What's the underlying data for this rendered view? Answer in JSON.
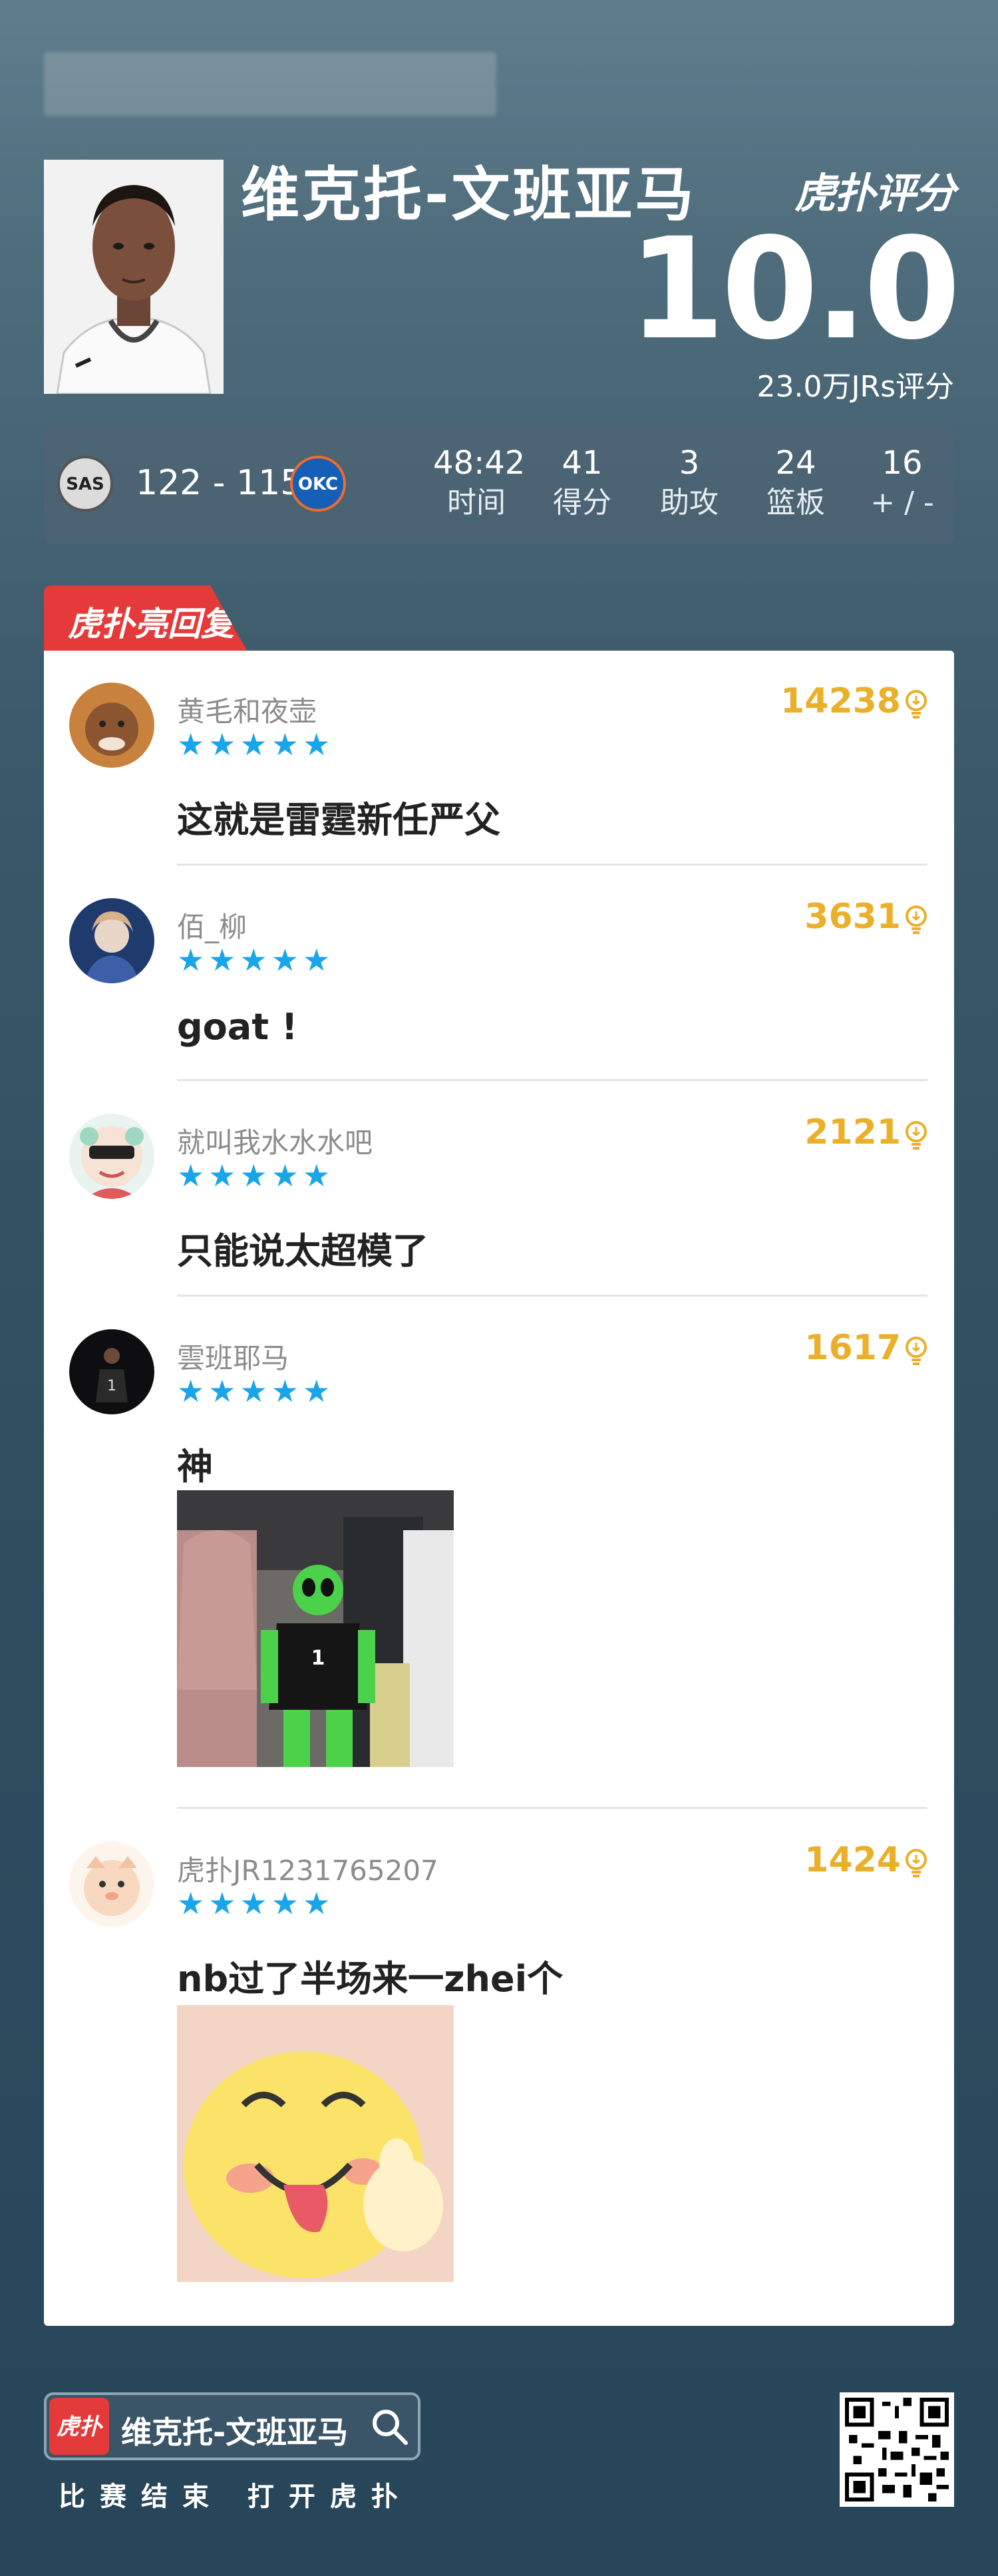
{
  "header": {
    "player_name": "维克托-文班亚马",
    "brand": "虎扑评分",
    "score": "10.0",
    "jrs_count": "23.0万JRs评分"
  },
  "game": {
    "home_team": "SAS",
    "away_team": "OKC",
    "score": "122 - 115",
    "stats": [
      {
        "value": "48:42",
        "label": "时间"
      },
      {
        "value": "41",
        "label": "得分"
      },
      {
        "value": "3",
        "label": "助攻"
      },
      {
        "value": "24",
        "label": "篮板"
      },
      {
        "value": "16",
        "label": "+ / -"
      }
    ]
  },
  "hot_tab_label": "虎扑亮回复",
  "comments": [
    {
      "user": "黄毛和夜壶",
      "stars": "★★★★★",
      "likes": "14238",
      "text": "这就是雷霆新任严父",
      "rating": 5
    },
    {
      "user": "佰_柳",
      "stars": "★★★★★",
      "likes": "3631",
      "text": "goat !",
      "rating": 5
    },
    {
      "user": "就叫我水水水吧",
      "stars": "★★★★★",
      "likes": "2121",
      "text": "只能说太超模了",
      "rating": 5
    },
    {
      "user": "雲班耶马",
      "stars": "★★★★★",
      "likes": "1617",
      "text": "神",
      "rating": 5
    },
    {
      "user": "虎扑JR1231765207",
      "stars": "★★★★★",
      "likes": "1424",
      "text": "nb过了半场来一zhei个",
      "rating": 5
    }
  ],
  "footer": {
    "logo_text": "虎扑",
    "search_text": "维克托-文班亚马",
    "cta": "比赛结束 打开虎扑"
  },
  "colors": {
    "accent_red": "#e53a3a",
    "star_blue": "#19a5e8",
    "likes_gold": "#ebb02a"
  }
}
